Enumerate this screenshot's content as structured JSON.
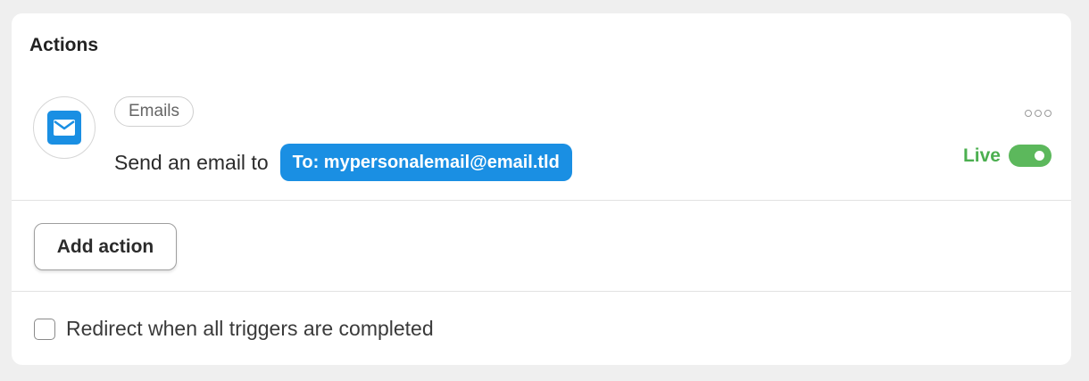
{
  "section": {
    "title": "Actions"
  },
  "action": {
    "icon": "envelope-icon",
    "category": "Emails",
    "description": "Send an email to",
    "recipient": "To: mypersonalemail@email.tld",
    "status_label": "Live",
    "status_enabled": true,
    "menu_icon": "more-horizontal-icon"
  },
  "buttons": {
    "add_action": "Add action"
  },
  "options": {
    "redirect_label": "Redirect when all triggers are completed",
    "redirect_checked": false
  },
  "colors": {
    "accent": "#1a8fe3",
    "live_green": "#4caf50",
    "toggle_green": "#5cb85c",
    "background": "#efefef"
  }
}
